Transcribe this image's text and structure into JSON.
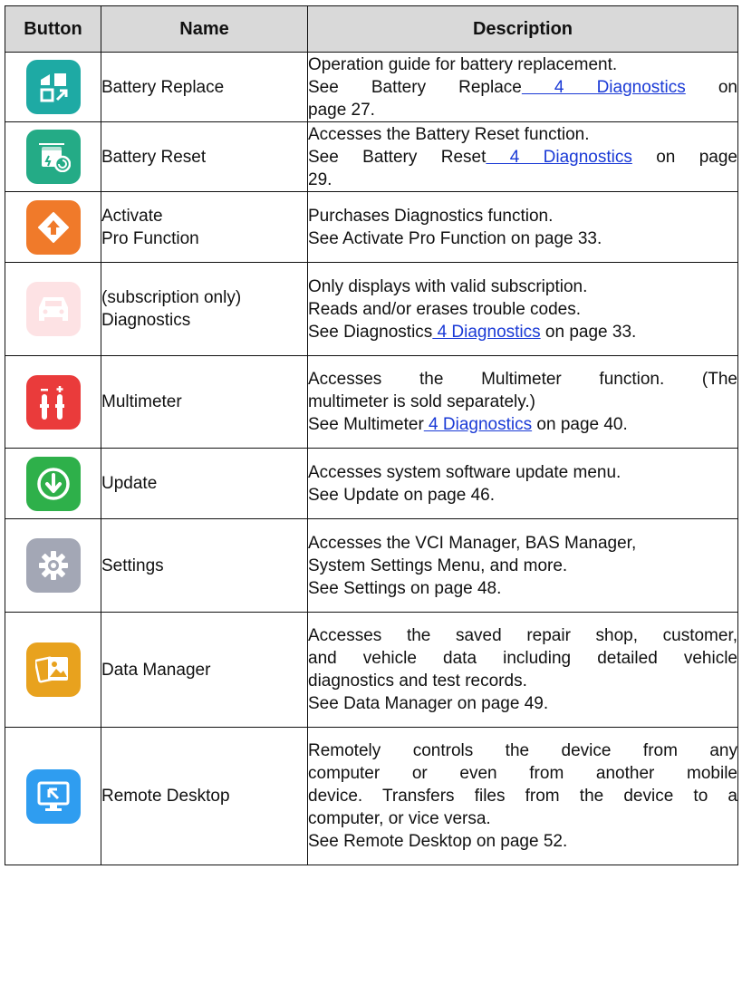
{
  "headers": [
    "Button",
    "Name",
    "Description"
  ],
  "rows": [
    {
      "icon": "battery-replace-icon",
      "color": "#1eaaa4",
      "name": [
        "Battery Replace"
      ],
      "desc": [
        {
          "text": "Operation guide for battery replacement."
        },
        {
          "pre": "See Battery Replace",
          "link": " 4 Diagnostics",
          "post": " on",
          "justify": true
        },
        {
          "text": "page 27."
        }
      ]
    },
    {
      "icon": "battery-reset-icon",
      "color": "#24ab86",
      "name": [
        "Battery Reset"
      ],
      "desc": [
        {
          "text": "Accesses the Battery Reset function."
        },
        {
          "pre": "See Battery Reset",
          "link": " 4 Diagnostics",
          "post": " on page",
          "justify": true
        },
        {
          "text": "29."
        }
      ]
    },
    {
      "icon": "activate-pro-icon",
      "color": "#f07a2a",
      "name": [
        "Activate",
        "Pro Function"
      ],
      "desc": [
        {
          "text": "Purchases Diagnostics function."
        },
        {
          "text": "See Activate Pro Function on page 33."
        }
      ]
    },
    {
      "icon": "diagnostics-car-icon",
      "color": "#fde2e4",
      "name": [
        "(subscription only)",
        "Diagnostics"
      ],
      "desc": [
        {
          "text": "Only displays with valid subscription."
        },
        {
          "text": "Reads and/or erases trouble codes."
        },
        {
          "pre": "See Diagnostics",
          "link": " 4 Diagnostics",
          "post": " on page 33."
        }
      ]
    },
    {
      "icon": "multimeter-icon",
      "color": "#ea3b3b",
      "name": [
        "Multimeter"
      ],
      "desc": [
        {
          "text": "Accesses the Multimeter function. (The",
          "justify": true
        },
        {
          "text": "multimeter is sold separately.)"
        },
        {
          "pre": "See Multimeter",
          "link": " 4 Diagnostics",
          "post": " on page 40."
        }
      ]
    },
    {
      "icon": "update-icon",
      "color": "#2eb04a",
      "name": [
        "Update"
      ],
      "desc": [
        {
          "text": "Accesses system software update menu."
        },
        {
          "text": "See Update on page 46."
        }
      ]
    },
    {
      "icon": "settings-gear-icon",
      "color": "#a3a7b5",
      "name": [
        "Settings"
      ],
      "desc": [
        {
          "text": "Accesses the VCI Manager, BAS Manager,"
        },
        {
          "text": "System Settings Menu, and more."
        },
        {
          "text": "See Settings on page 48."
        }
      ]
    },
    {
      "icon": "data-manager-icon",
      "color": "#e8a21e",
      "name": [
        "Data Manager"
      ],
      "desc": [
        {
          "text": "Accesses the saved repair shop, customer,",
          "justify": true
        },
        {
          "text": "and vehicle data including detailed vehicle",
          "justify": true
        },
        {
          "text": "diagnostics and test records."
        },
        {
          "text": "See Data Manager on page 49."
        }
      ]
    },
    {
      "icon": "remote-desktop-icon",
      "color": "#2f9df0",
      "name": [
        "Remote Desktop"
      ],
      "desc": [
        {
          "text": "Remotely controls the device from any",
          "justify": true
        },
        {
          "text": "computer or even from another mobile",
          "justify": true
        },
        {
          "text": "device. Transfers files from the device to a",
          "justify": true
        },
        {
          "text": "computer, or vice versa."
        },
        {
          "text": "See Remote Desktop on page 52."
        }
      ]
    }
  ]
}
